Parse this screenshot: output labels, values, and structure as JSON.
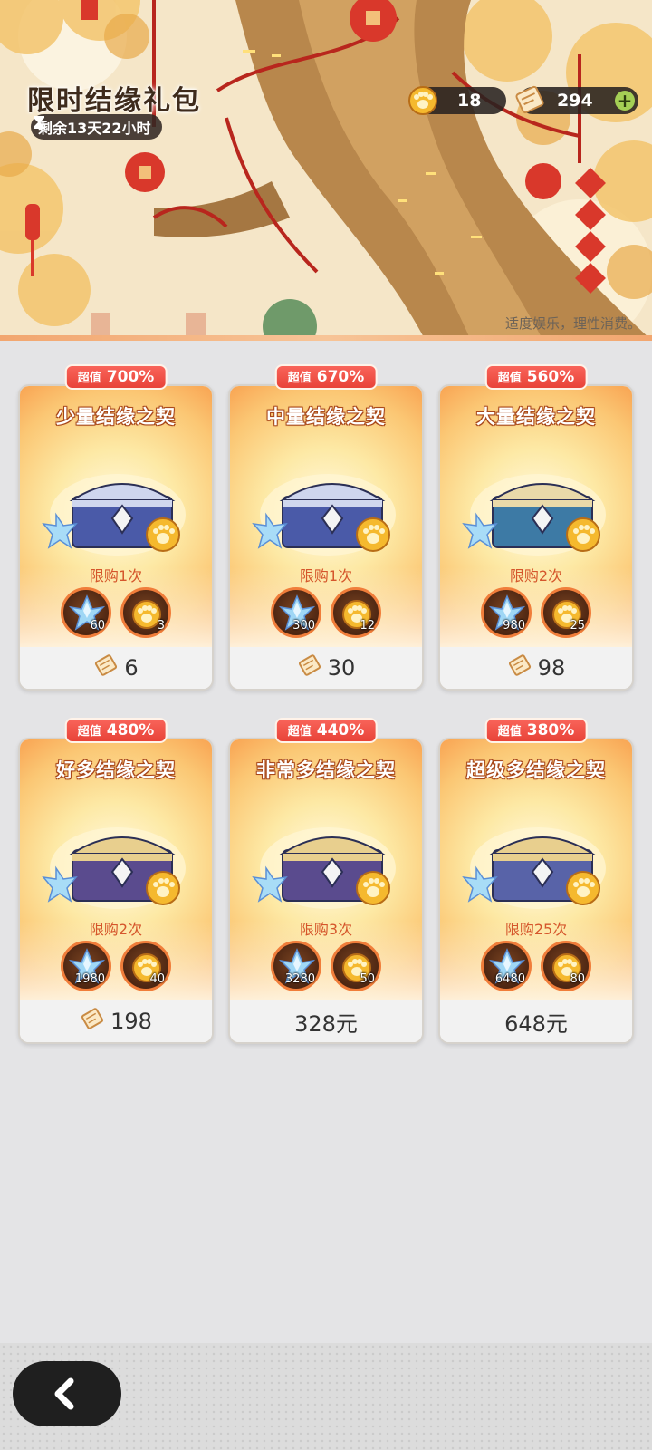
{
  "header": {
    "title": "限时结缘礼包",
    "timer": "剩余13天22小时",
    "notice": "适度娱乐，理性消费。"
  },
  "currencies": {
    "paw": {
      "value": "18",
      "icon": "paw-token-icon"
    },
    "ticket": {
      "value": "294",
      "icon": "ticket-icon",
      "add": "+"
    }
  },
  "packs": [
    {
      "badge_prefix": "超值",
      "badge": "700%",
      "name": "少量结缘之契",
      "limit": "限购1次",
      "crystal": "60",
      "paw": "3",
      "price": "6",
      "price_icon": true
    },
    {
      "badge_prefix": "超值",
      "badge": "670%",
      "name": "中量结缘之契",
      "limit": "限购1次",
      "crystal": "300",
      "paw": "12",
      "price": "30",
      "price_icon": true
    },
    {
      "badge_prefix": "超值",
      "badge": "560%",
      "name": "大量结缘之契",
      "limit": "限购2次",
      "crystal": "980",
      "paw": "25",
      "price": "98",
      "price_icon": true
    },
    {
      "badge_prefix": "超值",
      "badge": "480%",
      "name": "好多结缘之契",
      "limit": "限购2次",
      "crystal": "1980",
      "paw": "40",
      "price": "198",
      "price_icon": true
    },
    {
      "badge_prefix": "超值",
      "badge": "440%",
      "name": "非常多结缘之契",
      "limit": "限购3次",
      "crystal": "3280",
      "paw": "50",
      "price": "328元",
      "price_icon": false
    },
    {
      "badge_prefix": "超值",
      "badge": "380%",
      "name": "超级多结缘之契",
      "limit": "限购25次",
      "crystal": "6480",
      "paw": "80",
      "price": "648元",
      "price_icon": false
    }
  ],
  "colors": {
    "badge": "#ea4a3f",
    "limit_text": "#d5562c",
    "card_glow": "#fbc774"
  },
  "footer": {
    "back_icon": "chevron-left-icon"
  }
}
